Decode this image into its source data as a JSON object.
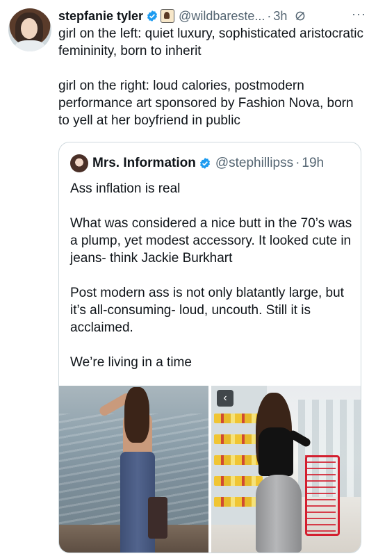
{
  "tweet": {
    "author_name": "stepfanie tyler",
    "handle": "@wildbareste...",
    "separator": "·",
    "time": "3h",
    "more": "···",
    "text": "girl on the left: quiet luxury, sophisticated aristocratic femininity, born to inherit\n\ngirl on the right: loud calories, postmodern performance art sponsored by Fashion Nova, born to yell at her boyfriend in public"
  },
  "quoted": {
    "author_name": "Mrs. Information",
    "handle": "@stephillipss",
    "separator": "·",
    "time": "19h",
    "text": "Ass inflation is real\n\nWhat was considered a nice butt in the 70’s was a plump, yet modest accessory. It looked cute in jeans- think Jackie Burkhart\n\nPost modern ass is not only blatantly large, but it’s all-consuming- loud, uncouth. Still it is acclaimed.\n\nWe’re living in a time",
    "nav_prev": "‹"
  },
  "icons": {
    "verified_color": "#1d9bf0",
    "verified": "verified-badge-icon",
    "emoji": "portrait-emoji-icon",
    "grok": "grok-icon",
    "more": "more-dots-icon"
  }
}
